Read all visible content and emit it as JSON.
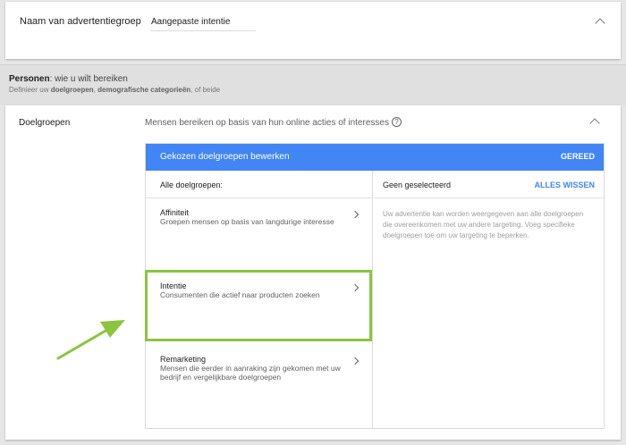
{
  "adgroup": {
    "label": "Naam van advertentiegroep",
    "value": "Aangepaste intentie"
  },
  "section": {
    "title_bold": "Personen",
    "title_rest": ": wie u wilt bereiken",
    "sub_pre": "Definieer uw ",
    "sub_b1": "doelgroepen",
    "sub_mid": ", ",
    "sub_b2": "demografische categorieën",
    "sub_post": ", of beide"
  },
  "audiences": {
    "label": "Doelgroepen",
    "header": "Mensen bereiken op basis van hun online acties of interesses",
    "help_glyph": "?",
    "panel_title": "Gekozen doelgroepen bewerken",
    "done": "GEREED",
    "all_label": "Alle doelgroepen:",
    "items": [
      {
        "title": "Affiniteit",
        "desc": "Groepen mensen op basis van langdurige interesse"
      },
      {
        "title": "Intentie",
        "desc": "Consumenten die actief naar producten zoeken"
      },
      {
        "title": "Remarketing",
        "desc": "Mensen die eerder in aanraking zijn gekomen met uw bedrijf en vergelijkbare doelgroepen"
      }
    ],
    "none_selected": "Geen geselecteerd",
    "clear_all": "ALLES WISSEN",
    "message": "Uw advertentie kan worden weergegeven aan alle doelgroepen die overeenkomen met uw andere targeting. Voeg specifieke doelgroepen toe om uw targeting te beperken."
  },
  "colors": {
    "accent": "#4285f4",
    "highlight": "#8bc53f"
  },
  "icons": {
    "collapse": "chevron-up-icon",
    "expand_item": "chevron-right-icon",
    "help": "help-icon",
    "annotation": "arrow-icon"
  }
}
